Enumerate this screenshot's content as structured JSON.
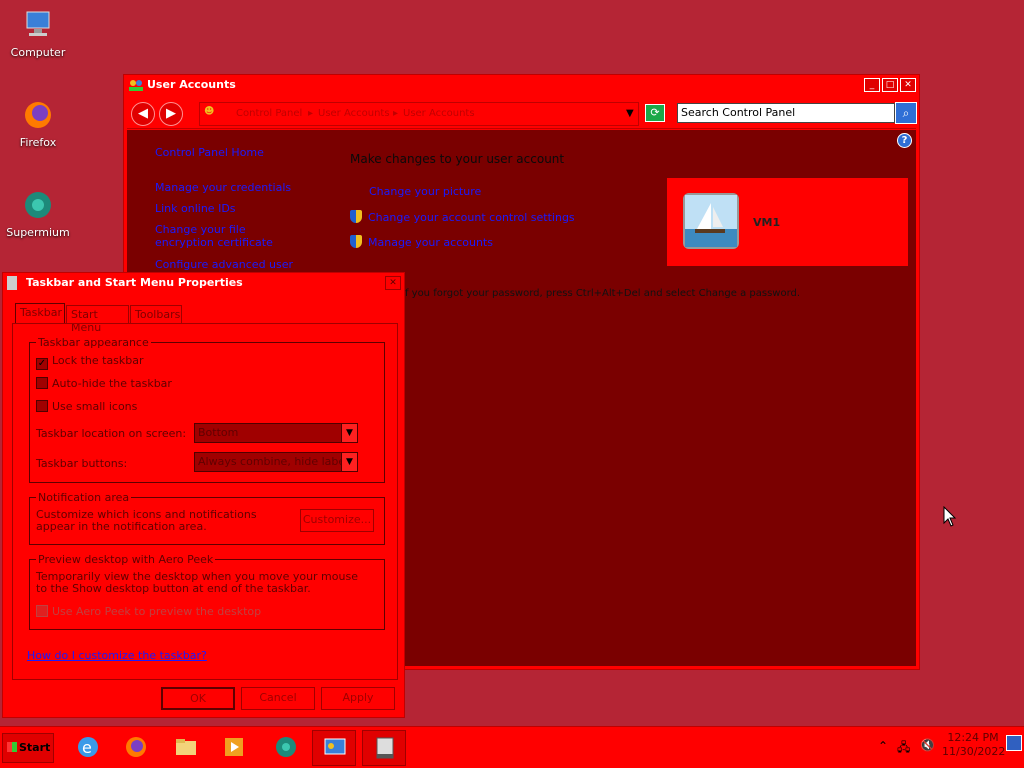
{
  "desktop": {
    "icons": [
      {
        "label": "Computer",
        "icon": "computer-icon"
      },
      {
        "label": "Firefox",
        "icon": "firefox-icon"
      },
      {
        "label": "Supermium",
        "icon": "supermium-icon"
      }
    ]
  },
  "user_accounts_window": {
    "title": "User Accounts",
    "breadcrumb": [
      "Control Panel",
      "User Accounts",
      "User Accounts"
    ],
    "search_placeholder": "Search Control Panel",
    "sidebar": [
      "Control Panel Home",
      "Manage your credentials",
      "Link online IDs",
      "Change your file encryption certificate",
      "Configure advanced user profile properties"
    ],
    "heading": "Make changes to your user account",
    "tasks": [
      "Change your picture",
      "Change your account control settings",
      "Manage your accounts"
    ],
    "user_name": "VM1",
    "password_note": "If you forgot your password, press Ctrl+Alt+Del and select Change a password."
  },
  "taskbar_dialog": {
    "title": "Taskbar and Start Menu Properties",
    "tabs": [
      "Taskbar",
      "Start Menu",
      "Toolbars"
    ],
    "appearance_group": {
      "label": "Taskbar appearance",
      "lock": {
        "label": "Lock the taskbar",
        "checked": true
      },
      "autohide": {
        "label": "Auto-hide the taskbar",
        "checked": false
      },
      "small_icons": {
        "label": "Use small icons",
        "checked": false
      },
      "location_label": "Taskbar location on screen:",
      "location_value": "Bottom",
      "buttons_label": "Taskbar buttons:",
      "buttons_value": "Always combine, hide labels"
    },
    "notification_group": {
      "label": "Notification area",
      "text": "Customize which icons and notifications appear in the notification area.",
      "button": "Customize..."
    },
    "peek_group": {
      "label": "Preview desktop with Aero Peek",
      "text": "Temporarily view the desktop when you move your mouse to the Show desktop button at end of the taskbar.",
      "checkbox": "Use Aero Peek to preview the desktop"
    },
    "help_link": "How do I customize the taskbar?",
    "buttons": {
      "ok": "OK",
      "cancel": "Cancel",
      "apply": "Apply"
    }
  },
  "taskbar": {
    "start_label": "Start",
    "apps": [
      "internet-explorer-icon",
      "firefox-icon",
      "file-explorer-icon",
      "media-player-icon",
      "supermium-icon",
      "control-panel-icon",
      "taskbar-properties-icon"
    ],
    "time": "12:24 PM",
    "date": "11/30/2022"
  },
  "colors": {
    "accent_red": "#ff0000",
    "desktop": "#b52535",
    "content_dark": "#7a0000",
    "link": "#1a1aff"
  }
}
